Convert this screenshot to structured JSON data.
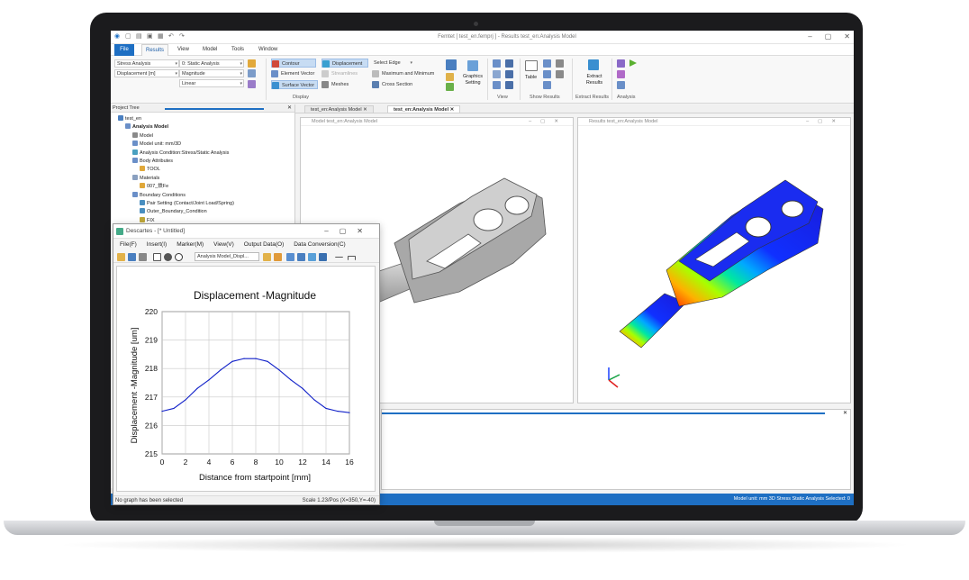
{
  "app": {
    "title": "Femtet [ test_en.femprj ] - Results test_en:Analysis Model",
    "ribbon_tabs": [
      "File",
      "Results",
      "View",
      "Model",
      "Tools",
      "Window"
    ],
    "active_tab": "Results"
  },
  "ribbon": {
    "result_type": "Stress Analysis",
    "analysis_kind": "0: Static Analysis",
    "quantity": "Displacement [m]",
    "component": "Magnitude",
    "scale": "Linear",
    "display": {
      "contour": "Contour",
      "displacement": "Displacement",
      "element_vector": "Element Vector",
      "streamlines": "Streamlines",
      "surface_vector": "Surface Vector",
      "meshes": "Meshes",
      "select_edge": "Select Edge",
      "max_min": "Maximum and Minimum",
      "cross_section": "Cross Section",
      "graphics_setting": "Graphics Setting",
      "group_label": "Display"
    },
    "view_label": "View",
    "table_label": "Table",
    "show_results_label": "Show Results",
    "extract_results": "Extract Results",
    "extract_results_group": "Extract Results",
    "analysis_label": "Analysis"
  },
  "project_tree": {
    "header": "Project Tree",
    "items": [
      {
        "label": "test_en",
        "indent": 0
      },
      {
        "label": "Analysis Model",
        "indent": 1,
        "bold": true
      },
      {
        "label": "Model",
        "indent": 2
      },
      {
        "label": "Model unit: mm/3D",
        "indent": 2
      },
      {
        "label": "Analysis Condition:Stress/Static Analysis",
        "indent": 2
      },
      {
        "label": "Body Attributes",
        "indent": 2
      },
      {
        "label": "TOOL",
        "indent": 3
      },
      {
        "label": "Materials",
        "indent": 2
      },
      {
        "label": "007_鉄Fe",
        "indent": 3
      },
      {
        "label": "Boundary Conditions",
        "indent": 2
      },
      {
        "label": "Pair Setting (Contact/Joint Load/Spring)",
        "indent": 3
      },
      {
        "label": "Outer_Boundary_Condition",
        "indent": 3
      },
      {
        "label": "FIX",
        "indent": 3
      }
    ]
  },
  "doc_tabs": [
    "test_en:Analysis Model",
    "test_en:Analysis Model"
  ],
  "views": {
    "left_title": "Model test_en:Analysis Model",
    "right_title": "Results test_en:Analysis Model"
  },
  "statusbar": {
    "right": "Model unit: mm  3D  Stress  Static Analysis  Selected: 0"
  },
  "dialog": {
    "title": "Descartes - [* Untitled]",
    "menu": [
      "File(F)",
      "Insert(I)",
      "Marker(M)",
      "View(V)",
      "Output Data(O)",
      "Data Conversion(C)"
    ],
    "combo": "Analysis Model_Displ...",
    "status_left": "No graph has been selected",
    "status_right": "Scale 1.23/Pos (X=350,Y=-40)"
  },
  "colors": {
    "accent": "#1e6fc3",
    "series": "#1020c8"
  },
  "chart_data": {
    "type": "line",
    "title": "Displacement -Magnitude",
    "xlabel": "Distance from startpoint [mm]",
    "ylabel": "Displacement -Magnitude [um]",
    "xlim": [
      0,
      16
    ],
    "ylim": [
      215,
      220
    ],
    "xticks": [
      0,
      2,
      4,
      6,
      8,
      10,
      12,
      14,
      16
    ],
    "yticks": [
      215,
      216,
      217,
      218,
      219,
      220
    ],
    "grid": true,
    "series": [
      {
        "x": [
          0,
          1,
          2,
          3,
          4,
          5,
          6,
          7,
          8,
          9,
          10,
          11,
          12,
          13,
          14,
          15,
          16
        ],
        "y": [
          216.5,
          216.6,
          216.9,
          217.3,
          217.6,
          217.95,
          218.25,
          218.35,
          218.35,
          218.25,
          217.95,
          217.6,
          217.3,
          216.9,
          216.6,
          216.5,
          216.45
        ]
      }
    ]
  }
}
